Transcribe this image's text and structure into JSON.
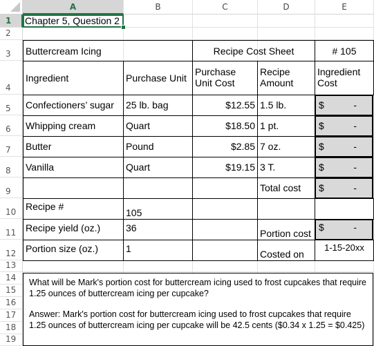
{
  "columns": [
    "A",
    "B",
    "C",
    "D",
    "E"
  ],
  "selected_column": "A",
  "rows": [
    "1",
    "2",
    "3",
    "4",
    "5",
    "6",
    "7",
    "8",
    "9",
    "10",
    "11",
    "12",
    "13",
    "14",
    "15",
    "16",
    "17",
    "18",
    "19"
  ],
  "selected_row": "1",
  "title_cell": "Chapter 5, Question 2",
  "header": {
    "recipe_name": "Buttercream Icing",
    "sheet_title": "Recipe Cost Sheet",
    "recipe_number_label": "# 105"
  },
  "column_headers": {
    "ingredient": "Ingredient",
    "purchase_unit": "Purchase Unit",
    "purchase_unit_cost_1": "Purchase",
    "purchase_unit_cost_2": "Unit Cost",
    "recipe_amount_1": "Recipe",
    "recipe_amount_2": "Amount",
    "ingredient_cost_1": "Ingredient",
    "ingredient_cost_2": "Cost"
  },
  "ingredients": [
    {
      "name": "Confectioners’ sugar",
      "unit": "25 lb. bag",
      "unit_cost": "$12.55",
      "amount": "1.5 lb.",
      "cost_symbol": "$",
      "cost_value": "-"
    },
    {
      "name": "Whipping cream",
      "unit": "Quart",
      "unit_cost": "$18.50",
      "amount": "1 pt.",
      "cost_symbol": "$",
      "cost_value": "-"
    },
    {
      "name": "Butter",
      "unit": "Pound",
      "unit_cost": "$2.85",
      "amount": "7 oz.",
      "cost_symbol": "$",
      "cost_value": "-"
    },
    {
      "name": "Vanilla",
      "unit": "Quart",
      "unit_cost": "$19.15",
      "amount": "3 T.",
      "cost_symbol": "$",
      "cost_value": "-"
    }
  ],
  "total": {
    "label": "Total cost",
    "symbol": "$",
    "value": "-"
  },
  "recipe_info": {
    "recipe_num_label": "Recipe #",
    "recipe_num_value": "105",
    "yield_label": "Recipe yield (oz.)",
    "yield_value": "36",
    "portion_size_label": "Portion size (oz.)",
    "portion_size_value": "1",
    "portion_cost_label": "Portion cost",
    "portion_cost_symbol": "$",
    "portion_cost_value": "-",
    "costed_on_label": "Costed on",
    "costed_on_value": "1-15-20xx"
  },
  "textbox": {
    "question": "What will be Mark's portion cost for buttercream icing used to frost cupcakes that require 1.25 ounces of buttercream icing per cupcake?",
    "answer": "Answer:  Mark's portion cost for buttercream icing used to frost cupcakes that require 1.25 ounces of buttercream icing per cupcake will be 42.5 cents ($0.34 x 1.25 = $0.425)"
  }
}
